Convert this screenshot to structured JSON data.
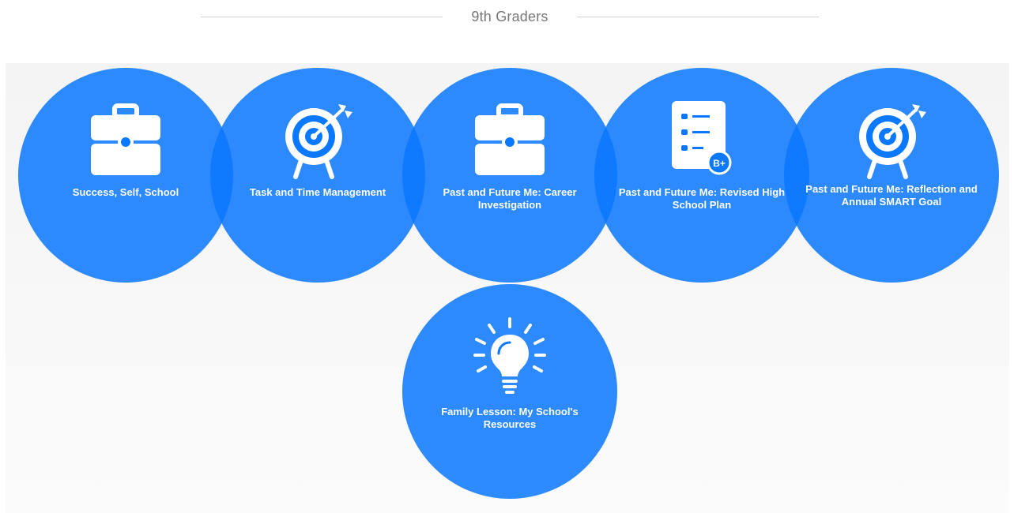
{
  "header": {
    "title": "9th Graders"
  },
  "lessons": [
    {
      "label": "Success, Self, School",
      "icon": "briefcase-icon"
    },
    {
      "label": "Task and Time Management",
      "icon": "target-icon"
    },
    {
      "label": "Past and Future Me: Career Investigation",
      "icon": "briefcase-icon"
    },
    {
      "label": "Past and Future Me: Revised High School Plan",
      "icon": "report-card-icon"
    },
    {
      "label": "Past and Future Me: Reflection and Annual SMART Goal",
      "icon": "target-icon"
    },
    {
      "label": "Family Lesson: My School's Resources",
      "icon": "lightbulb-icon"
    }
  ],
  "icons": {
    "report_card_grade": "B+"
  },
  "colors": {
    "circle": "#0A78FF",
    "panel": "#F4F4F4",
    "header_text": "#777777"
  }
}
